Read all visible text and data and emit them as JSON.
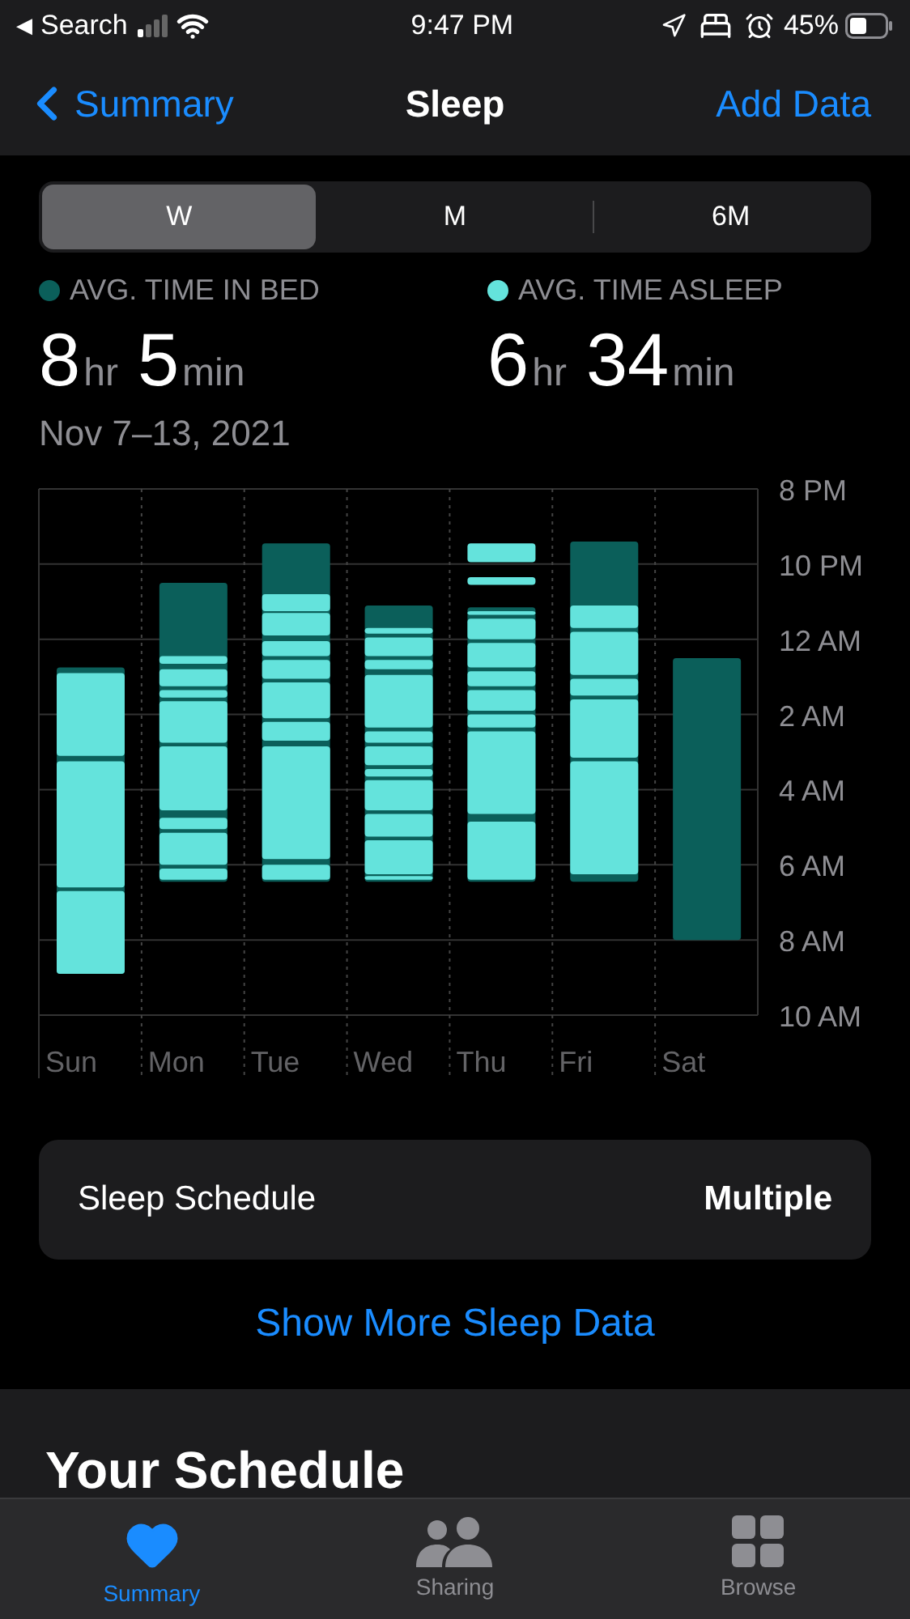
{
  "status_bar": {
    "back_glyph": "◀",
    "back_label": "Search",
    "time": "9:47 PM",
    "battery": "45%"
  },
  "nav": {
    "back": "Summary",
    "title": "Sleep",
    "action": "Add Data"
  },
  "segments": [
    {
      "label": "W",
      "selected": true
    },
    {
      "label": "M",
      "selected": false
    },
    {
      "label": "6M",
      "selected": false
    }
  ],
  "stats": [
    {
      "label": "AVG. TIME IN BED",
      "color": "#0b5f5a",
      "hours": "8",
      "hours_unit": "hr",
      "minutes": "5",
      "minutes_unit": "min"
    },
    {
      "label": "AVG. TIME ASLEEP",
      "color": "#64e3dc",
      "hours": "6",
      "hours_unit": "hr",
      "minutes": "34",
      "minutes_unit": "min"
    }
  ],
  "date_range": "Nov 7–13, 2021",
  "sleep_chart": {
    "time_labels": [
      "8 PM",
      "10 PM",
      "12 AM",
      "2 AM",
      "4 AM",
      "6 AM",
      "8 AM",
      "10 AM"
    ],
    "day_labels": [
      "Sun",
      "Mon",
      "Tue",
      "Wed",
      "Thu",
      "Fri",
      "Sat"
    ]
  },
  "schedule_card": {
    "label": "Sleep Schedule",
    "value": "Multiple"
  },
  "more_link": "Show More Sleep Data",
  "section_heading": "Your Schedule",
  "tab_bar": [
    {
      "label": "Summary",
      "kind": "heart",
      "selected": true
    },
    {
      "label": "Sharing",
      "kind": "people",
      "selected": false
    },
    {
      "label": "Browse",
      "kind": "grid",
      "selected": false
    }
  ]
}
